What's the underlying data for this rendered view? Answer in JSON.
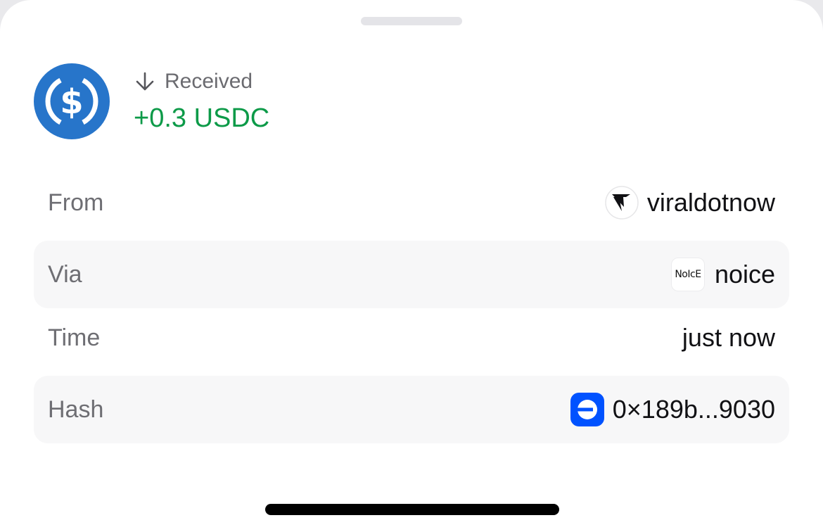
{
  "transaction": {
    "direction": "Received",
    "amount": "+0.3 USDC",
    "token_icon": "usdc-icon",
    "amount_color": "#0c9a48"
  },
  "rows": {
    "from": {
      "label": "From",
      "value": "viraldotnow",
      "icon": "viral-logo-icon"
    },
    "via": {
      "label": "Via",
      "value": "noice",
      "logo_text": "NoIcE",
      "icon": "noice-logo"
    },
    "time": {
      "label": "Time",
      "value": "just now"
    },
    "hash": {
      "label": "Hash",
      "value": "0×189b...9030",
      "icon": "base-chain-icon"
    }
  },
  "colors": {
    "usdc_blue": "#2775ca",
    "base_blue": "#0052ff",
    "row_shade": "#f7f7f8"
  }
}
